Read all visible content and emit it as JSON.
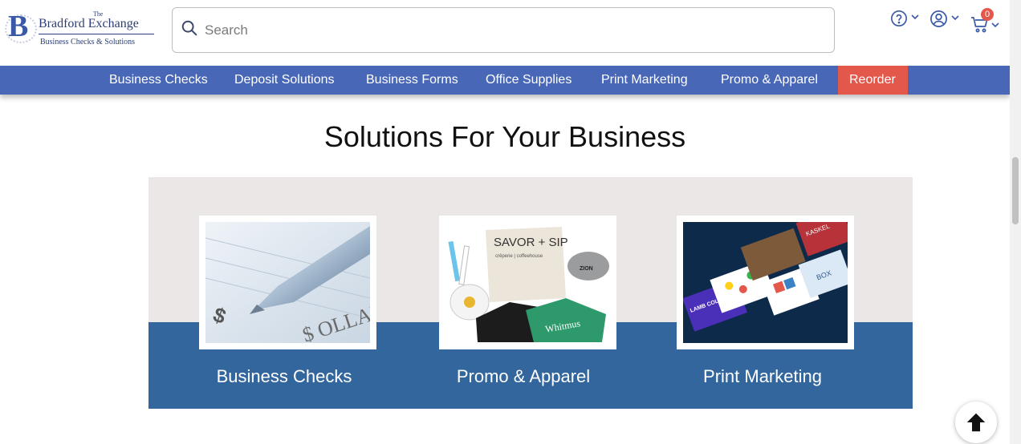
{
  "logo": {
    "the": "The",
    "name": "Bradford Exchange",
    "tagline": "Business Checks & Solutions",
    "monogram": "B"
  },
  "search": {
    "placeholder": "Search",
    "value": ""
  },
  "utility": {
    "help_icon": "question-circle-icon",
    "account_icon": "user-circle-icon",
    "cart_icon": "cart-icon",
    "cart_count": "0"
  },
  "nav": {
    "items": [
      {
        "label": "Business Checks"
      },
      {
        "label": "Deposit Solutions"
      },
      {
        "label": "Business Forms"
      },
      {
        "label": "Office Supplies"
      },
      {
        "label": "Print Marketing"
      },
      {
        "label": "Promo & Apparel"
      },
      {
        "label": "Reorder"
      }
    ]
  },
  "main": {
    "title": "Solutions For Your Business",
    "cards": [
      {
        "label": "Business Checks",
        "image_text": "$ OLLARS"
      },
      {
        "label": "Promo & Apparel",
        "image_text": "SAVOR + SIP",
        "image_sub": "crêperie | coffeehouse",
        "cap_text": "ZION",
        "shirt_text": "Whitmus"
      },
      {
        "label": "Print Marketing",
        "image_text": "BOX",
        "card2": "KASKEL",
        "card3": "LAMB COLLECTIVE"
      }
    ]
  },
  "colors": {
    "nav_bg": "#4867b7",
    "reorder_bg": "#e4584b",
    "panel_bg": "#ece7e7",
    "band_bg": "#33669d"
  }
}
